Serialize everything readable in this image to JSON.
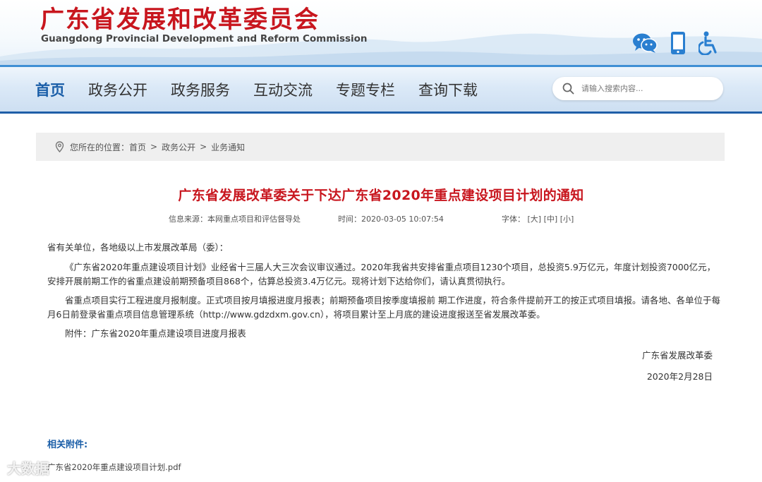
{
  "header": {
    "title_cn": "广东省发展和改革委员会",
    "title_en": "Guangdong Provincial Development and Reform Commission",
    "icons": [
      "wechat-icon",
      "mobile-icon",
      "accessibility-icon"
    ],
    "brand_red": "#c8161e",
    "brand_blue": "#1a5ea8"
  },
  "nav": {
    "items": [
      {
        "label": "首页",
        "active": true
      },
      {
        "label": "政务公开"
      },
      {
        "label": "政务服务"
      },
      {
        "label": "互动交流"
      },
      {
        "label": "专题专栏"
      },
      {
        "label": "查询下载"
      }
    ],
    "search": {
      "placeholder": "请输入搜索内容..."
    }
  },
  "breadcrumb": {
    "prefix": "您所在的位置：",
    "items": [
      "首页",
      "政务公开",
      "业务通知"
    ],
    "separator": ">"
  },
  "article": {
    "title": "广东省发展改革委关于下达广东省2020年重点建设项目计划的通知",
    "source": "信息来源：本网重点项目和评估督导处",
    "time": "时间：2020-03-05 10:07:54",
    "font_label": "字体：",
    "font_sizes": [
      "[大]",
      "[中]",
      "[小]"
    ],
    "salutation": "省有关单位，各地级以上市发展改革局（委）：",
    "paragraphs": [
      "《广东省2020年重点建设项目计划》业经省十三届人大三次会议审议通过。2020年我省共安排省重点项目1230个项目，总投资5.9万亿元，年度计划投资7000亿元，安排开展前期工作的省重点建设前期预备项目868个，估算总投资3.4万亿元。现将计划下达给你们，请认真贯彻执行。",
      "省重点项目实行工程进度月报制度。正式项目按月填报进度月报表；前期预备项目按季度填报前 期工作进度，符合条件提前开工的按正式项目填报。请各地、各单位于每月6日前登录省重点项目信息管理系统（http://www.gdzdxm.gov.cn），将项目累计至上月底的建设进度报送至省发展改革委。",
      "附件：广东省2020年重点建设项目进度月报表"
    ],
    "signature": "广东省发展改革委",
    "date": "2020年2月28日"
  },
  "related": {
    "title": "相关附件:",
    "link": "广东省2020年重点建设项目计划.pdf"
  },
  "watermark": "大数据"
}
